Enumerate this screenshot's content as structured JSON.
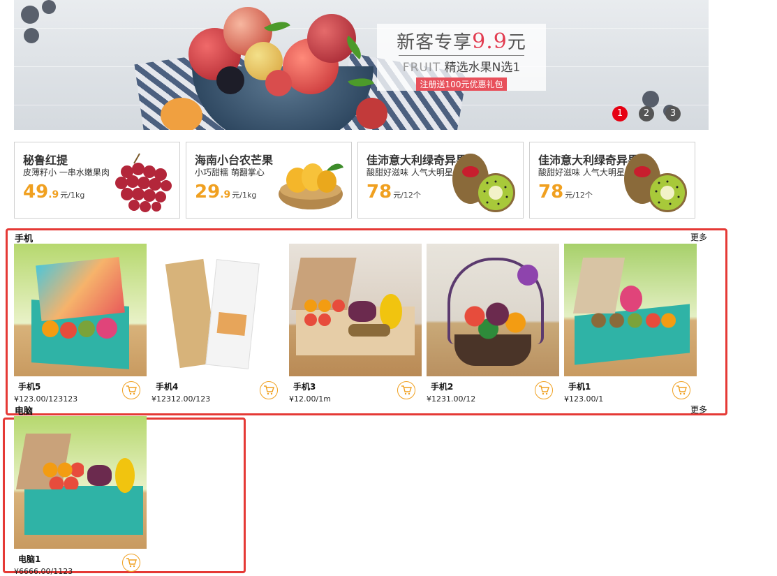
{
  "banner": {
    "promo_title": "新客专享",
    "promo_price": "9.9",
    "promo_price_unit": "元",
    "promo_en": "FRUIT",
    "promo_sub": "精选水果N选1",
    "promo_btn": "注册送100元优惠礼包",
    "dots": [
      "1",
      "2",
      "3"
    ],
    "active_dot": 0
  },
  "cards": [
    {
      "name": "秘鲁红提",
      "desc": "皮薄籽小 一串水嫩果肉",
      "price_int": "49",
      "price_dec": ".9",
      "unit": "元/1kg",
      "icon": "grapes-icon"
    },
    {
      "name": "海南小台农芒果",
      "desc": "小巧甜糯 萌翻掌心",
      "price_int": "29",
      "price_dec": ".9",
      "unit": "元/1kg",
      "icon": "mango-icon"
    },
    {
      "name": "佳沛意大利绿奇异果",
      "desc": "酸甜好滋味 人气大明星",
      "price_int": "78",
      "price_dec": "",
      "unit": "元/12个",
      "icon": "kiwi-icon"
    },
    {
      "name": "佳沛意大利绿奇异果",
      "desc": "酸甜好滋味 人气大明星",
      "price_int": "78",
      "price_dec": "",
      "unit": "元/12个",
      "icon": "kiwi-icon"
    }
  ],
  "sections": [
    {
      "title": "手机",
      "more": "更多",
      "products": [
        {
          "name": "手机5",
          "price": "¥123.00/123123"
        },
        {
          "name": "手机4",
          "price": "¥12312.00/123"
        },
        {
          "name": "手机3",
          "price": "¥12.00/1m"
        },
        {
          "name": "手机2",
          "price": "¥1231.00/12"
        },
        {
          "name": "手机1",
          "price": "¥123.00/1"
        }
      ]
    },
    {
      "title": "电脑",
      "more": "更多",
      "products": [
        {
          "name": "电脑1",
          "price": "¥6666.00/1123"
        }
      ]
    }
  ],
  "colors": {
    "accent": "#e60012",
    "price": "#f0a020",
    "frame": "#e53935"
  }
}
